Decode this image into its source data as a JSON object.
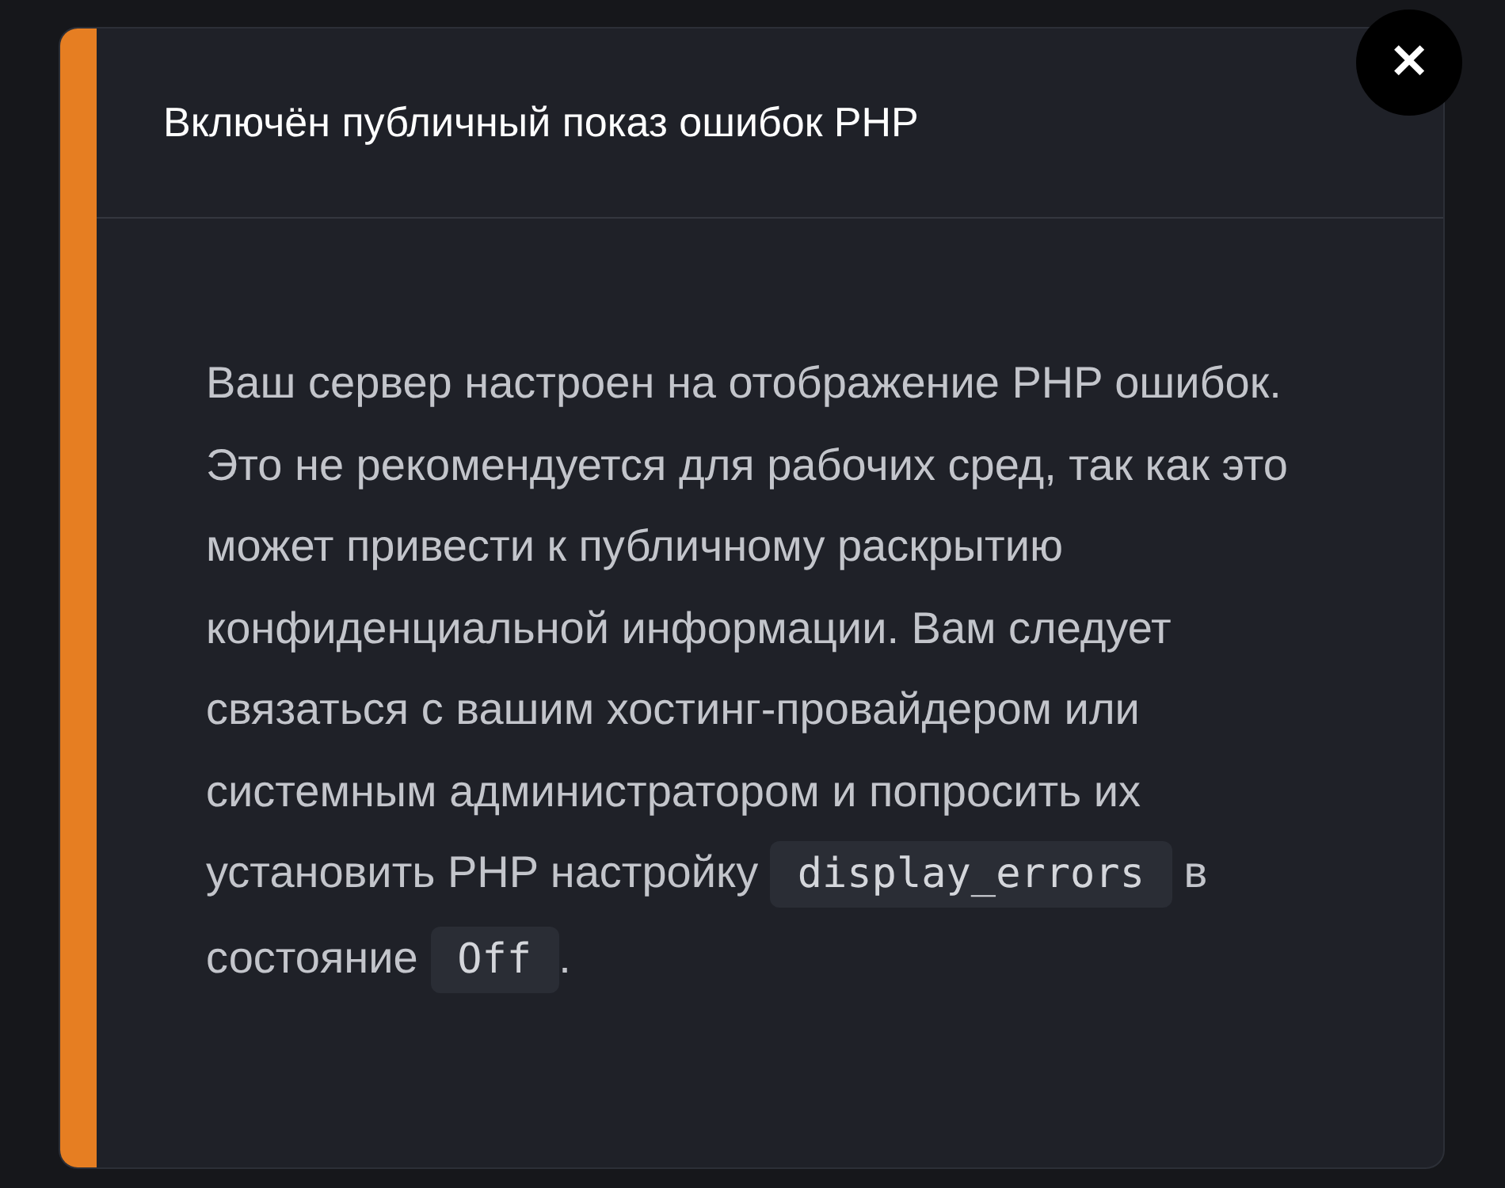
{
  "notice": {
    "title": "Включён публичный показ ошибок PHP",
    "body": [
      {
        "kind": "text",
        "text": "Ваш сервер настроен на отображение PHP ошибок. Это не рекомендуется для рабочих сред, так как это может привести к публичному раскрытию конфиденциальной информации. Вам следует связаться с вашим хостинг-провайдером или системным администратором и попросить их установить PHP настройку "
      },
      {
        "kind": "code",
        "text": "display_errors"
      },
      {
        "kind": "text",
        "text": " в состояние "
      },
      {
        "kind": "code",
        "text": "Off"
      },
      {
        "kind": "text",
        "text": "."
      }
    ],
    "close": "✕"
  }
}
